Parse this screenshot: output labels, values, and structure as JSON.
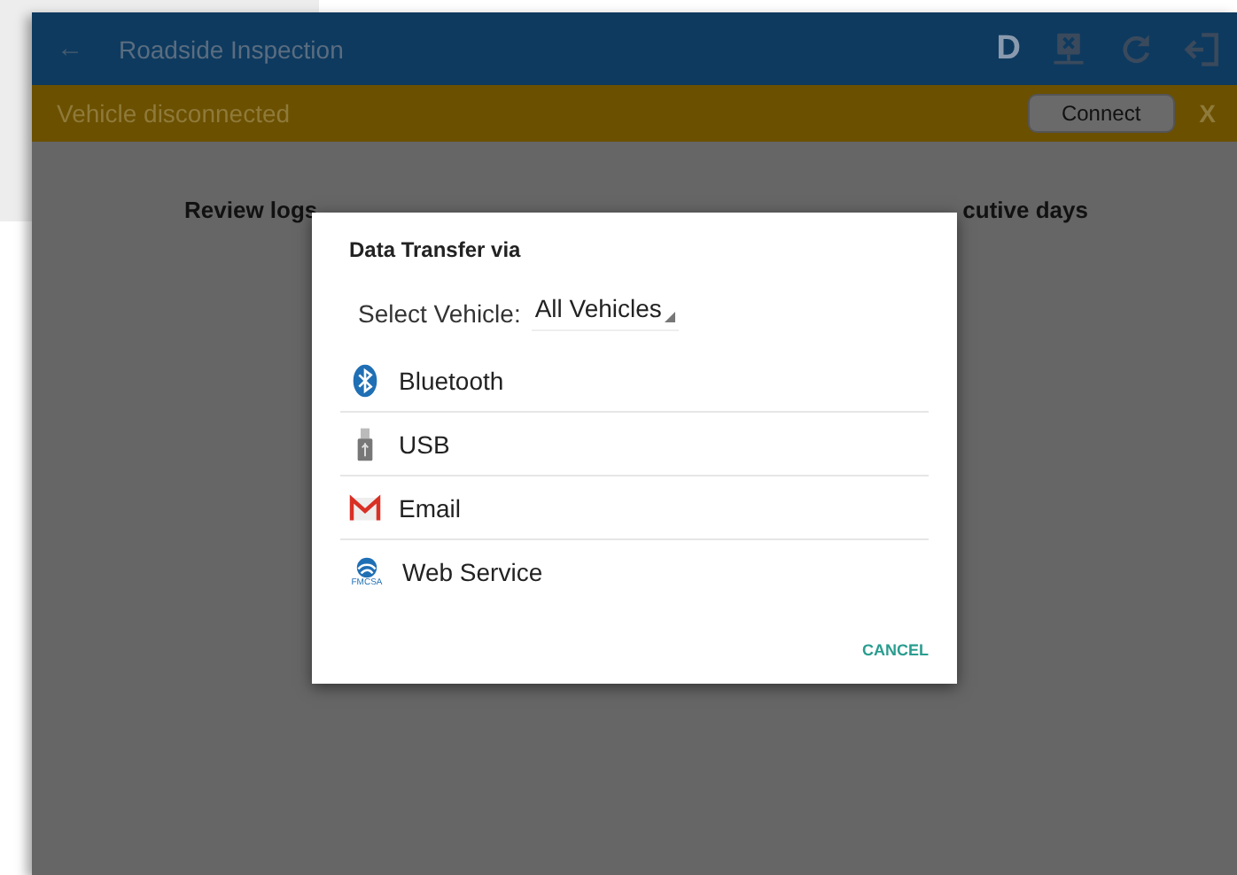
{
  "app_bar": {
    "back": "←",
    "title": "Roadside Inspection",
    "driver_badge": "D"
  },
  "banner": {
    "message": "Vehicle disconnected",
    "button": "Connect",
    "close": "X"
  },
  "body": {
    "text_left": "Review logs",
    "text_right": "cutive days"
  },
  "dialog": {
    "title": "Data Transfer via",
    "select_label": "Select Vehicle:",
    "select_value": "All Vehicles",
    "options": [
      {
        "kind": "bluetooth",
        "label": "Bluetooth"
      },
      {
        "kind": "usb",
        "label": "USB"
      },
      {
        "kind": "email",
        "label": "Email"
      },
      {
        "kind": "web",
        "label": "Web Service",
        "icon_text": "FMCSA"
      }
    ],
    "cancel": "CANCEL"
  }
}
